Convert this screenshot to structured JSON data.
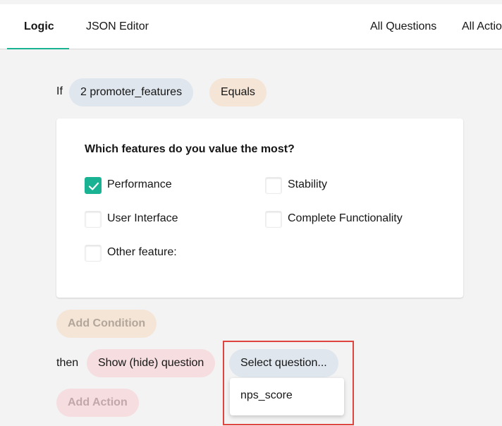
{
  "tabs": {
    "logic": "Logic",
    "json_editor": "JSON Editor",
    "all_questions": "All Questions",
    "all_actions": "All Actio"
  },
  "condition": {
    "if_label": "If",
    "question": "2 promoter_features",
    "operator": "Equals"
  },
  "question_card": {
    "title": "Which features do you value the most?",
    "options": [
      {
        "label": "Performance",
        "checked": true
      },
      {
        "label": "Stability",
        "checked": false
      },
      {
        "label": "User Interface",
        "checked": false
      },
      {
        "label": "Complete Functionality",
        "checked": false
      },
      {
        "label": "Other feature:",
        "checked": false
      }
    ]
  },
  "add_condition_label": "Add Condition",
  "action": {
    "then_label": "then",
    "type": "Show (hide) question",
    "target_placeholder": "Select question...",
    "dropdown_items": [
      "nps_score"
    ]
  },
  "add_action_label": "Add Action",
  "colors": {
    "accent": "#19b394",
    "highlight": "#e0443e"
  }
}
